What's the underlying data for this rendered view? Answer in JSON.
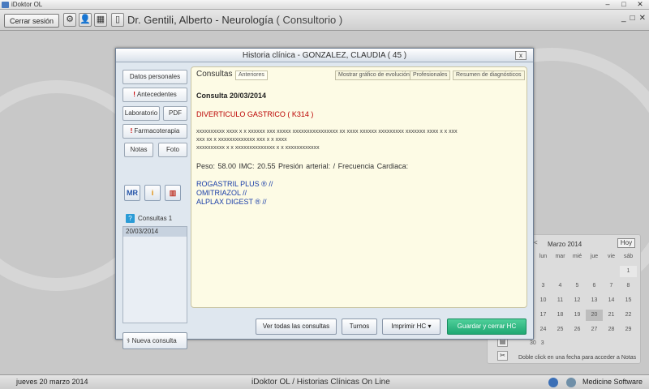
{
  "window": {
    "title": "iDoktor OL",
    "controls": [
      "–",
      "□",
      "✕"
    ]
  },
  "toolbar": {
    "logout_label": "Cerrar sesión",
    "doctor": "Dr. Gentili, Alberto - Neurología",
    "context": "( Consultorio )",
    "controls": [
      "_",
      "□",
      "✕"
    ]
  },
  "modal": {
    "title": "Historia clínica - GONZALEZ, CLAUDIA ( 45 )",
    "close": "x",
    "nav": {
      "personal_data": "Datos personales",
      "background": "Antecedentes",
      "lab": "Laboratorio",
      "pdf": "PDF",
      "pharma": "Farmacoterapia",
      "notes": "Notas",
      "photo": "Foto",
      "mr": "MR"
    },
    "consults_label": "Consultas 1",
    "consults_marker": "?",
    "consult_list": [
      "20/03/2014"
    ],
    "new_consult": "Nueva consulta",
    "tabs": {
      "main": "Consultas",
      "previous": "Anteriores",
      "chart": "Mostrar gráfico de evolución",
      "professionals": "Profesionales",
      "summary": "Resumen de diagnósticos"
    },
    "consult": {
      "header": "Consulta 20/03/2014",
      "diagnosis": "DIVERTICULO GASTRICO ( K314 )",
      "notes": [
        "xxxxxxxxxx xxxx x x xxxxxx xxx xxxxx xxxxxxxxxxxxxxxx xx xxxx xxxxxx xxxxxxxxx xxxxxxx xxxx x x xxx",
        "xxx xx x xxxxxxxxxxxxx xxx x x xxxx",
        "xxxxxxxxxx x x  xxxxxxxxxxxxxx x x xxxxxxxxxxxx"
      ],
      "vitals": "Peso: 58.00   IMC: 20.55   Presión arterial:  /    Frecuencia Cardiaca:",
      "meds": [
        "ROGASTRIL PLUS ® //",
        "OMITRIAZOL //",
        "ALPLAX DIGEST ® //"
      ]
    },
    "buttons": {
      "all_consults": "Ver todas las consultas",
      "shifts": "Turnos",
      "print": "Imprimir HC",
      "save_close": "Guardar y cerrar HC"
    }
  },
  "calendar": {
    "month": "Marzo 2014",
    "prev": "<",
    "today_button": "Hoy",
    "weekdays": [
      "lun",
      "mar",
      "mié",
      "jue",
      "vie",
      "sáb"
    ],
    "days": [
      "",
      "",
      "",
      "",
      "",
      "1",
      "3",
      "4",
      "5",
      "6",
      "7",
      "8",
      "10",
      "11",
      "12",
      "13",
      "14",
      "15",
      "17",
      "18",
      "19",
      "20",
      "21",
      "22",
      "24",
      "25",
      "26",
      "27",
      "28",
      "29"
    ],
    "extra_days": [
      "30",
      "3"
    ],
    "hint": "Doble click en una fecha para acceder a Notas"
  },
  "status": {
    "date": "jueves 20 marzo 2014",
    "center": "iDoktor OL  /  Historias Clínicas On Line",
    "brand": "Medicine Software"
  }
}
